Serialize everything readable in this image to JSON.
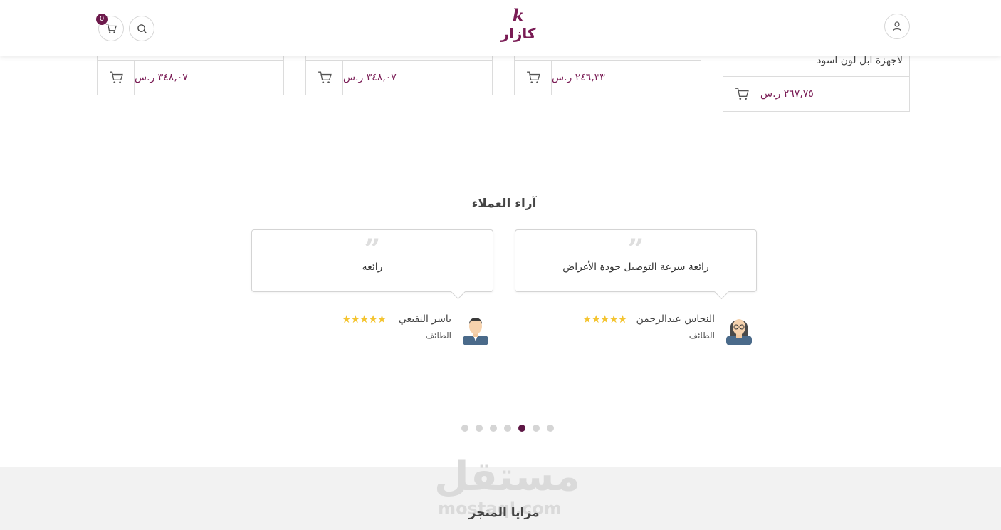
{
  "header": {
    "cart_count": "0",
    "logo_mark": "k",
    "logo_text": "كازار"
  },
  "products": [
    {
      "name": "لأجهزة ابل لون أسود",
      "price": "٢٦٧,٧٥ ر.س"
    },
    {
      "price": "٢٤٦,٣٣ ر.س"
    },
    {
      "price": "٣٤٨,٠٧ ر.س"
    },
    {
      "price": "٣٤٨,٠٧ ر.س"
    }
  ],
  "testimonials": {
    "title": "آراء العملاء",
    "items": [
      {
        "quote_mark": "”",
        "text": "رائعة سرعة التوصيل جودة الأغراض",
        "name": "النحاس عبدالرحمن",
        "city": "الطائف",
        "stars": "★★★★★"
      },
      {
        "quote_mark": "”",
        "text": "رائعه",
        "name": "ياسر النفيعي",
        "city": "الطائف",
        "stars": "★★★★★"
      }
    ],
    "pagination": {
      "count": 7,
      "active": 4
    }
  },
  "footer": {
    "title": "مزايا المتجر",
    "watermark": "مستقل",
    "watermark_sub": "mostaql.com"
  },
  "colors": {
    "brand": "#7a1c55",
    "active_dot": "#5e1745",
    "star": "#f4c430"
  }
}
